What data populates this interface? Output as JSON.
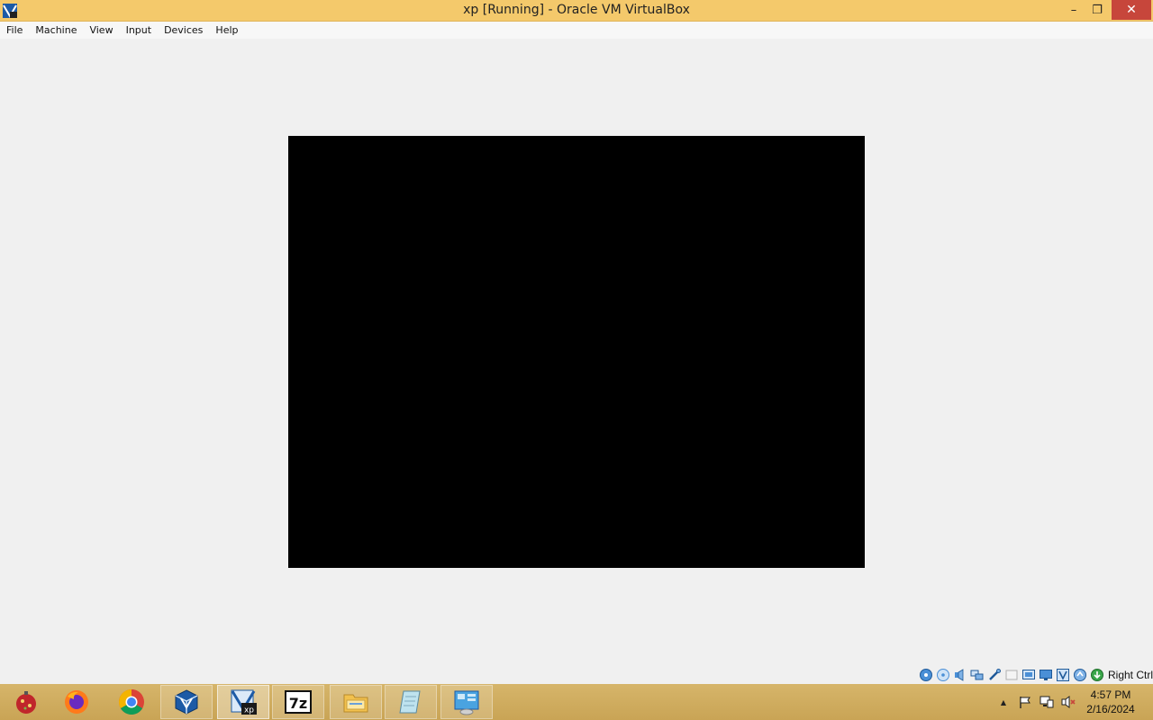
{
  "window": {
    "title": "xp [Running] - Oracle VM VirtualBox",
    "minimize_glyph": "–",
    "maximize_glyph": "❐",
    "close_glyph": "✕"
  },
  "menu": {
    "items": [
      {
        "label": "File"
      },
      {
        "label": "Machine"
      },
      {
        "label": "View"
      },
      {
        "label": "Input"
      },
      {
        "label": "Devices"
      },
      {
        "label": "Help"
      }
    ]
  },
  "statusbar": {
    "icons": [
      "hard-disk-icon",
      "optical-drive-icon",
      "audio-icon",
      "network-icon",
      "usb-icon",
      "shared-folders-icon",
      "display-icon",
      "video-capture-icon",
      "vt-x-icon",
      "mouse-integration-icon",
      "keyboard-capture-icon"
    ],
    "host_key": "Right Ctrl"
  },
  "taskbar": {
    "items": [
      {
        "name": "ornament-app-icon",
        "state": "normal"
      },
      {
        "name": "firefox-icon",
        "state": "normal"
      },
      {
        "name": "chrome-icon",
        "state": "normal"
      },
      {
        "name": "virtualbox-icon",
        "state": "open"
      },
      {
        "name": "xp-vm-icon",
        "state": "active"
      },
      {
        "name": "7zip-icon",
        "state": "open"
      },
      {
        "name": "file-explorer-icon",
        "state": "open"
      },
      {
        "name": "notepad-icon",
        "state": "open"
      },
      {
        "name": "control-panel-icon",
        "state": "open"
      }
    ],
    "sevenzip_label": "7z",
    "xp_label": "xp"
  },
  "tray": {
    "show_hidden_glyph": "▲",
    "clock_time": "4:57 PM",
    "clock_date": "2/16/2024"
  },
  "colors": {
    "titlebar": "#f4c96b",
    "close_button": "#c7463b",
    "taskbar": "#d6b56a",
    "vm_screen": "#000000"
  }
}
